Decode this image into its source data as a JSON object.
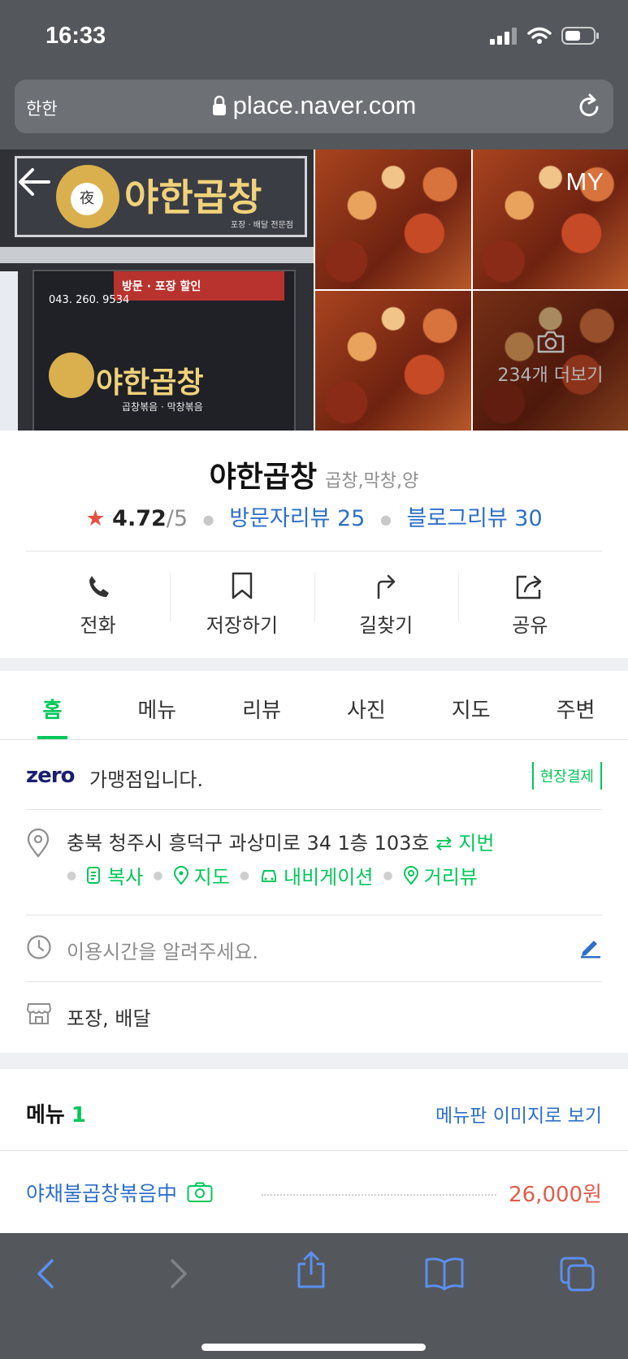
{
  "status_bar": {
    "time": "16:33"
  },
  "browser": {
    "text_size_label": "한한",
    "url": "place.naver.com"
  },
  "photos": {
    "more_label": "234개 더보기",
    "my_label": "MY",
    "sign_name": "야한곱창",
    "sign_hanja": "夜",
    "sign_sub": "포장 · 배달 전문점",
    "sign2_sub": "곱창볶음 · 막창볶음",
    "phone": "043. 260. 9534",
    "banner": "방문 · 포장 할인"
  },
  "place": {
    "name": "야한곱창",
    "category": "곱창,막창,양",
    "rating": "4.72",
    "rating_max": "/5",
    "visitor_reviews": "방문자리뷰 25",
    "blog_reviews": "블로그리뷰 30"
  },
  "actions": [
    {
      "label": "전화",
      "icon": "phone-icon"
    },
    {
      "label": "저장하기",
      "icon": "bookmark-icon"
    },
    {
      "label": "길찾기",
      "icon": "directions-icon"
    },
    {
      "label": "공유",
      "icon": "share-icon"
    }
  ],
  "tabs": [
    "홈",
    "메뉴",
    "리뷰",
    "사진",
    "지도",
    "주변"
  ],
  "zero_pay": {
    "logo": "zero",
    "text": "가맹점입니다.",
    "onsite_label": "현장결제"
  },
  "address": {
    "text": "충북 청주시 흥덕구 과상미로 34 1층 103호",
    "jibun_label": "⇄ 지번",
    "links": [
      "복사",
      "지도",
      "내비게이션",
      "거리뷰"
    ]
  },
  "hours": {
    "placeholder": "이용시간을 알려주세요."
  },
  "services": {
    "text": "포장, 배달"
  },
  "menu": {
    "title": "메뉴",
    "count": "1",
    "board_link": "메뉴판 이미지로 보기",
    "items": [
      {
        "name": "야채불곱창볶음中",
        "price": "26,000원"
      }
    ]
  },
  "colors": {
    "naver_green": "#03c75a",
    "link_blue": "#2e6fc9",
    "price_red": "#e05c4d",
    "star_red": "#e64f41",
    "chrome_gray": "#54575b"
  }
}
